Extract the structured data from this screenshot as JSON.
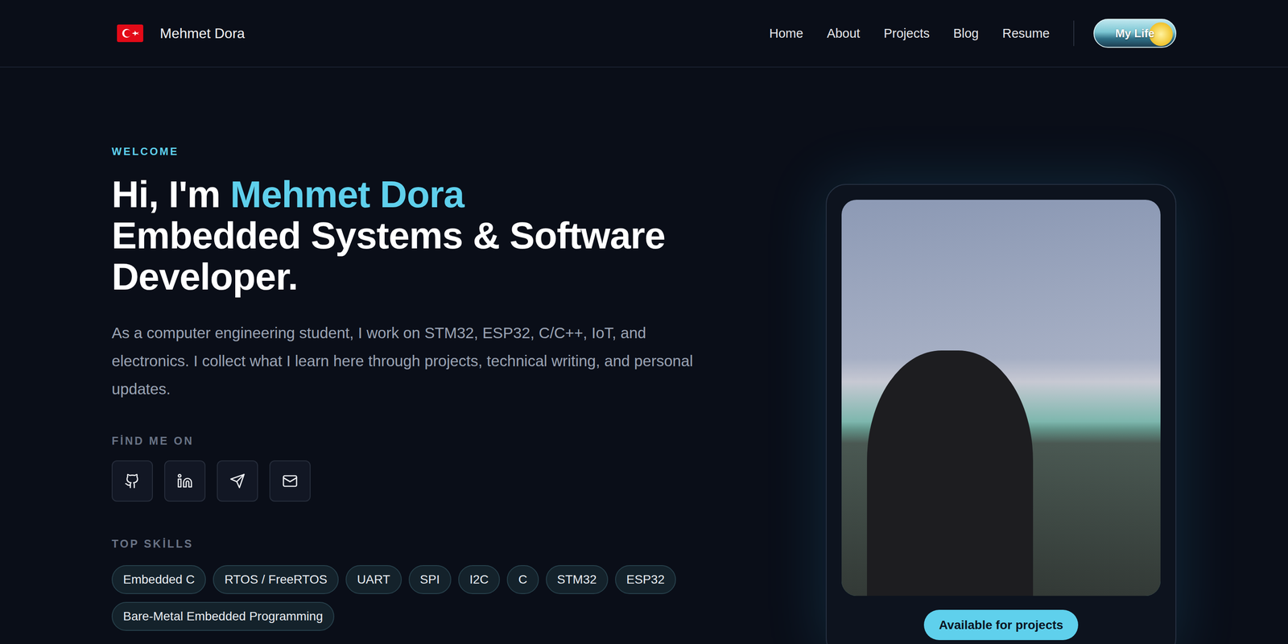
{
  "nav": {
    "brand": "Mehmet Dora",
    "links": [
      "Home",
      "About",
      "Projects",
      "Blog",
      "Resume"
    ],
    "cta": "My Life"
  },
  "hero": {
    "eyebrow": "WELCOME",
    "greeting": "Hi, I'm ",
    "name": "Mehmet Dora",
    "title": "Embedded Systems & Software Developer.",
    "intro": "As a computer engineering student, I work on STM32, ESP32, C/C++, IoT, and electronics. I collect what I learn here through projects, technical writing, and personal updates."
  },
  "socials": {
    "label": "FİND ME ON"
  },
  "skills": {
    "label": "TOP SKİLLS",
    "items": [
      "Embedded C",
      "RTOS / FreeRTOS",
      "UART",
      "SPI",
      "I2C",
      "C",
      "STM32",
      "ESP32",
      "Bare-Metal Embedded Programming"
    ]
  },
  "profile": {
    "badge": "Available for projects"
  }
}
